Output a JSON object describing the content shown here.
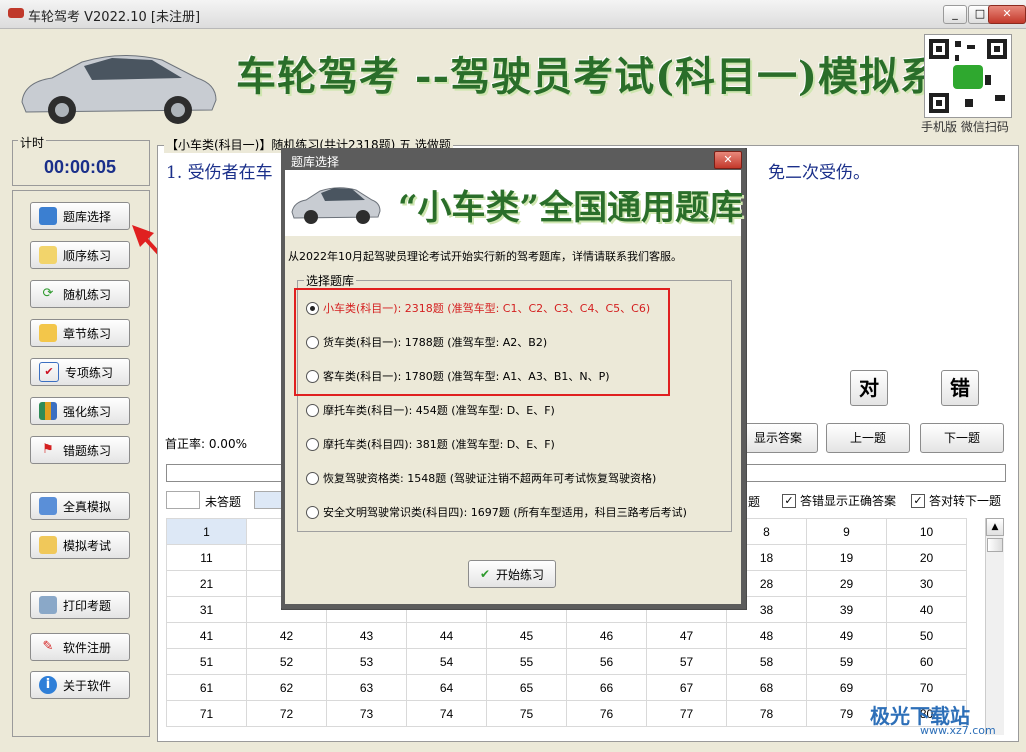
{
  "window": {
    "title": "车轮驾考 V2022.10 [未注册]",
    "buttons": [
      "_",
      "□",
      "✕"
    ]
  },
  "banner": {
    "title": "车轮驾考 --驾驶员考试(科目一)模拟系统",
    "qr_caption": "手机版 微信扫码"
  },
  "timer": {
    "label": "计时",
    "value": "00:00:05"
  },
  "nav": [
    {
      "label": "题库选择",
      "icon": "cubes-icon"
    },
    {
      "label": "顺序练习",
      "icon": "pencil-icon"
    },
    {
      "label": "随机练习",
      "icon": "refresh-icon"
    },
    {
      "label": "章节练习",
      "icon": "folder-icon"
    },
    {
      "label": "专项练习",
      "icon": "checkbox-icon"
    },
    {
      "label": "强化练习",
      "icon": "chart-icon"
    },
    {
      "label": "错题练习",
      "icon": "flag-icon"
    },
    {
      "label": "全真模拟",
      "icon": "grid-icon"
    },
    {
      "label": "模拟考试",
      "icon": "table-icon"
    },
    {
      "label": "打印考题",
      "icon": "printer-icon"
    },
    {
      "label": "软件注册",
      "icon": "syringe-icon"
    },
    {
      "label": "关于软件",
      "icon": "info-icon"
    }
  ],
  "question": {
    "header": "【小车类(科目一)】随机练习(共计2318题) 五 选做题",
    "text_left": "1. 受伤者在车",
    "text_right": "免二次受伤。"
  },
  "answer_buttons": {
    "right": "对",
    "wrong": "错",
    "show_answer": "显示答案",
    "prev": "上一题",
    "next": "下一题"
  },
  "accuracy": "首正率: 0.00%",
  "legend": {
    "unanswered": "未答题",
    "partial_label": "题"
  },
  "checkboxes": [
    {
      "label": "答错显示正确答案",
      "checked": true
    },
    {
      "label": "答对转下一题",
      "checked": true
    }
  ],
  "grid": {
    "rows": [
      [
        "1",
        "",
        "",
        "",
        "",
        "",
        "",
        "8",
        "9",
        "10"
      ],
      [
        "11",
        "",
        "",
        "",
        "",
        "",
        "",
        "18",
        "19",
        "20"
      ],
      [
        "21",
        "",
        "",
        "",
        "",
        "",
        "",
        "28",
        "29",
        "30"
      ],
      [
        "31",
        "",
        "",
        "",
        "",
        "",
        "",
        "38",
        "39",
        "40"
      ],
      [
        "41",
        "42",
        "43",
        "44",
        "45",
        "46",
        "47",
        "48",
        "49",
        "50"
      ],
      [
        "51",
        "52",
        "53",
        "54",
        "55",
        "56",
        "57",
        "58",
        "59",
        "60"
      ],
      [
        "61",
        "62",
        "63",
        "64",
        "65",
        "66",
        "67",
        "68",
        "69",
        "70"
      ],
      [
        "71",
        "72",
        "73",
        "74",
        "75",
        "76",
        "77",
        "78",
        "79",
        "80"
      ]
    ]
  },
  "dialog": {
    "title": "题库选择",
    "banner": "“小车类”全国通用题库",
    "notice": "从2022年10月起驾驶员理论考试开始实行新的驾考题库，详情请联系我们客服。",
    "group_label": "选择题库",
    "options": [
      {
        "label": "小车类(科目一): 2318题 (准驾车型: C1、C2、C3、C4、C5、C6)",
        "selected": true
      },
      {
        "label": "货车类(科目一): 1788题 (准驾车型: A2、B2)",
        "selected": false
      },
      {
        "label": "客车类(科目一): 1780题 (准驾车型: A1、A3、B1、N、P)",
        "selected": false
      },
      {
        "label": "摩托车类(科目一): 454题 (准驾车型: D、E、F)",
        "selected": false
      },
      {
        "label": "摩托车类(科目四): 381题 (准驾车型: D、E、F)",
        "selected": false
      },
      {
        "label": "恢复驾驶资格类: 1548题 (驾驶证注销不超两年可考试恢复驾驶资格)",
        "selected": false
      },
      {
        "label": "安全文明驾驶常识类(科目四): 1697题 (所有车型适用，科目三路考后考试)",
        "selected": false
      }
    ],
    "start_button": "开始练习"
  },
  "watermark": {
    "main": "极光下载站",
    "sub": "www.xz7.com"
  }
}
